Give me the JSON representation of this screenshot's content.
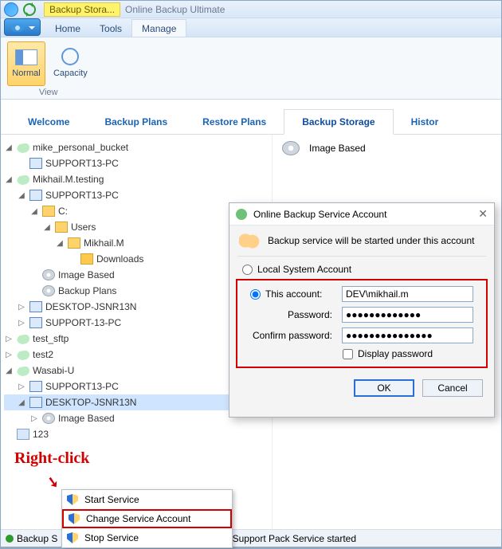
{
  "titlebar": {
    "tab_hint": "Backup Stora...",
    "app_title": "Online Backup Ultimate"
  },
  "ribbon": {
    "tabs": {
      "home": "Home",
      "tools": "Tools",
      "manage": "Manage"
    },
    "btn_normal": "Normal",
    "btn_capacity": "Capacity",
    "group_view": "View"
  },
  "maintabs": {
    "welcome": "Welcome",
    "backup_plans": "Backup Plans",
    "restore_plans": "Restore Plans",
    "backup_storage": "Backup Storage",
    "history": "Histor"
  },
  "tree": {
    "n0": "mike_personal_bucket",
    "n0_0": "SUPPORT13-PC",
    "n1": "Mikhail.M.testing",
    "n1_0": "SUPPORT13-PC",
    "n1_0_0": "C:",
    "n1_0_0_0": "Users",
    "n1_0_0_0_0": "Mikhail.M",
    "n1_0_0_0_0_0": "Downloads",
    "n1_0_1": "Image Based",
    "n1_0_2": "Backup Plans",
    "n1_1": "DESKTOP-JSNR13N",
    "n1_2": "SUPPORT-13-PC",
    "n2": "test_sftp",
    "n3": "test2",
    "n4": "Wasabi-U",
    "n4_0": "SUPPORT13-PC",
    "n4_1": "DESKTOP-JSNR13N",
    "n4_1_0": "Image Based",
    "n5": "123"
  },
  "detail": {
    "image_based": "Image Based"
  },
  "status": {
    "backup": "Backup S",
    "support": "Support Pack Service started"
  },
  "ctx": {
    "start": "Start Service",
    "change": "Change Service Account",
    "stop": "Stop Service"
  },
  "dlg": {
    "title": "Online Backup Service Account",
    "subtitle": "Backup service will be started under this account",
    "opt_local": "Local System Account",
    "opt_this": "This account:",
    "account_value": "DEV\\mikhail.m",
    "pwd_label": "Password:",
    "pwd_value": "●●●●●●●●●●●●●",
    "cpwd_label": "Confirm password:",
    "cpwd_value": "●●●●●●●●●●●●●●●",
    "display": "Display password",
    "ok": "OK",
    "cancel": "Cancel"
  },
  "anno": {
    "rightclick": "Right-click"
  }
}
